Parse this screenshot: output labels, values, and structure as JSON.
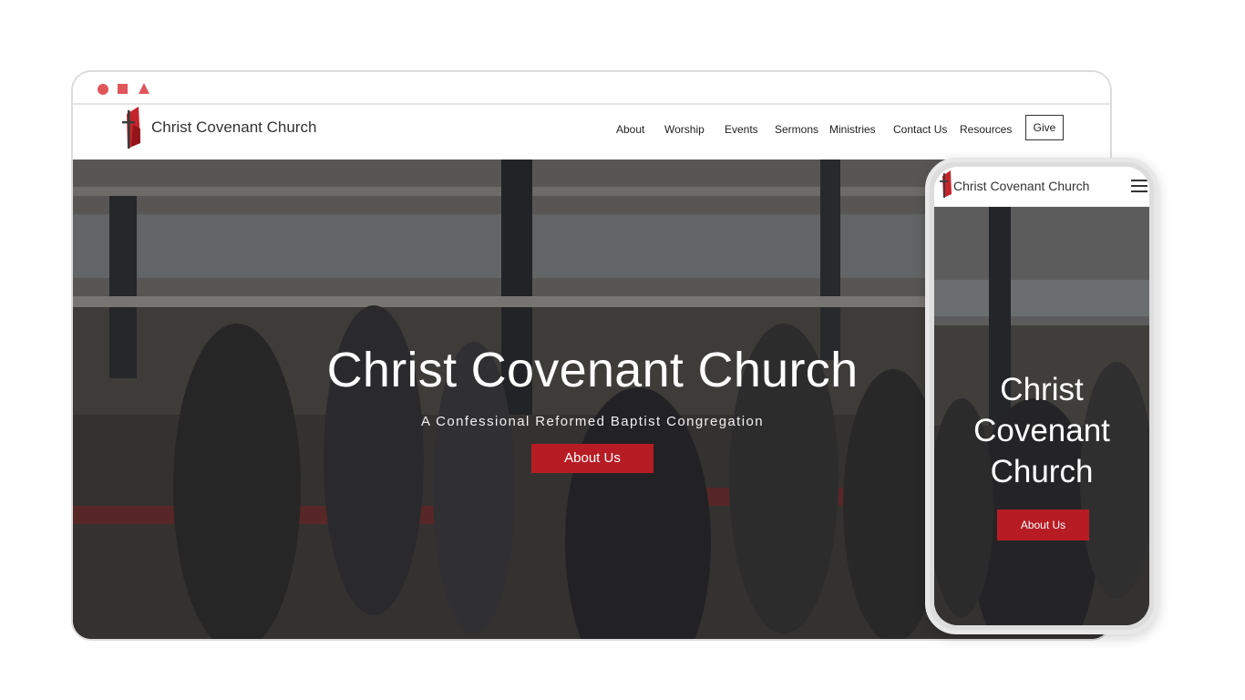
{
  "site": {
    "brand": "Christ Covenant Church",
    "nav": [
      "About",
      "Worship",
      "Events",
      "Sermons",
      "Ministries",
      "Contact Us",
      "Resources"
    ],
    "give_label": "Give"
  },
  "hero": {
    "title": "Christ Covenant Church",
    "subtitle": "A Confessional Reformed Baptist Congregation",
    "button_label": "About Us"
  },
  "mobile": {
    "brand": "Christ Covenant Church",
    "title_lines": [
      "Christ",
      "Covenant",
      "Church"
    ],
    "button_label": "About Us",
    "menu_icon": "hamburger-menu-icon"
  },
  "window_controls": [
    "circle-icon",
    "square-icon",
    "triangle-icon"
  ],
  "colors": {
    "accent": "#b71c24",
    "window_control": "#e0565b",
    "logo_red": "#c4242b",
    "hero_overlay": "#1e1e1e"
  }
}
